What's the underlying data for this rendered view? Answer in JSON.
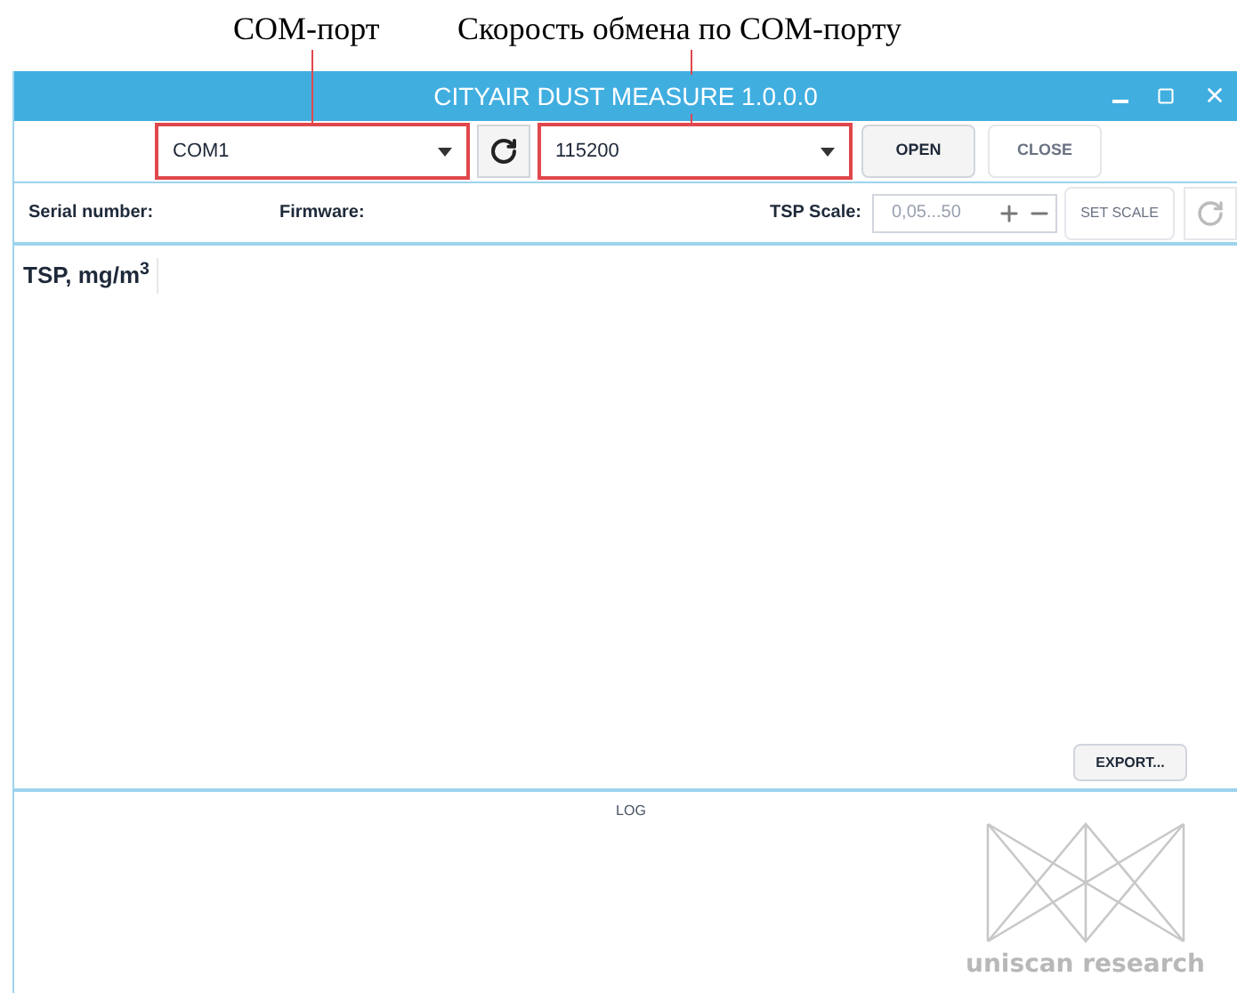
{
  "annotations": [
    {
      "text": "COM-порт"
    },
    {
      "text": "Скорость обмена по COM-порту"
    }
  ],
  "window": {
    "title": "CITYAIR DUST MEASURE 1.0.0.0"
  },
  "toolbar": {
    "port_select": {
      "value": "COM1",
      "highlighted": true
    },
    "baud_select": {
      "value": "115200",
      "highlighted": true
    },
    "buttons": [
      {
        "label": "OPEN",
        "disabled": false
      },
      {
        "label": "CLOSE",
        "disabled": true
      }
    ]
  },
  "info_bar": {
    "serial_label": "Serial number:",
    "firmware_label": "Firmware:",
    "scale_label": "TSP Scale:",
    "scale_value": "0,05...50",
    "set_scale": {
      "label": "SET SCALE",
      "disabled": true
    }
  },
  "chart": {
    "axis_label": "TSP, mg/m$^{3}$",
    "export_button": "EXPORT..."
  },
  "log": {
    "title": "LOG",
    "logo_text": "uniscan research"
  }
}
